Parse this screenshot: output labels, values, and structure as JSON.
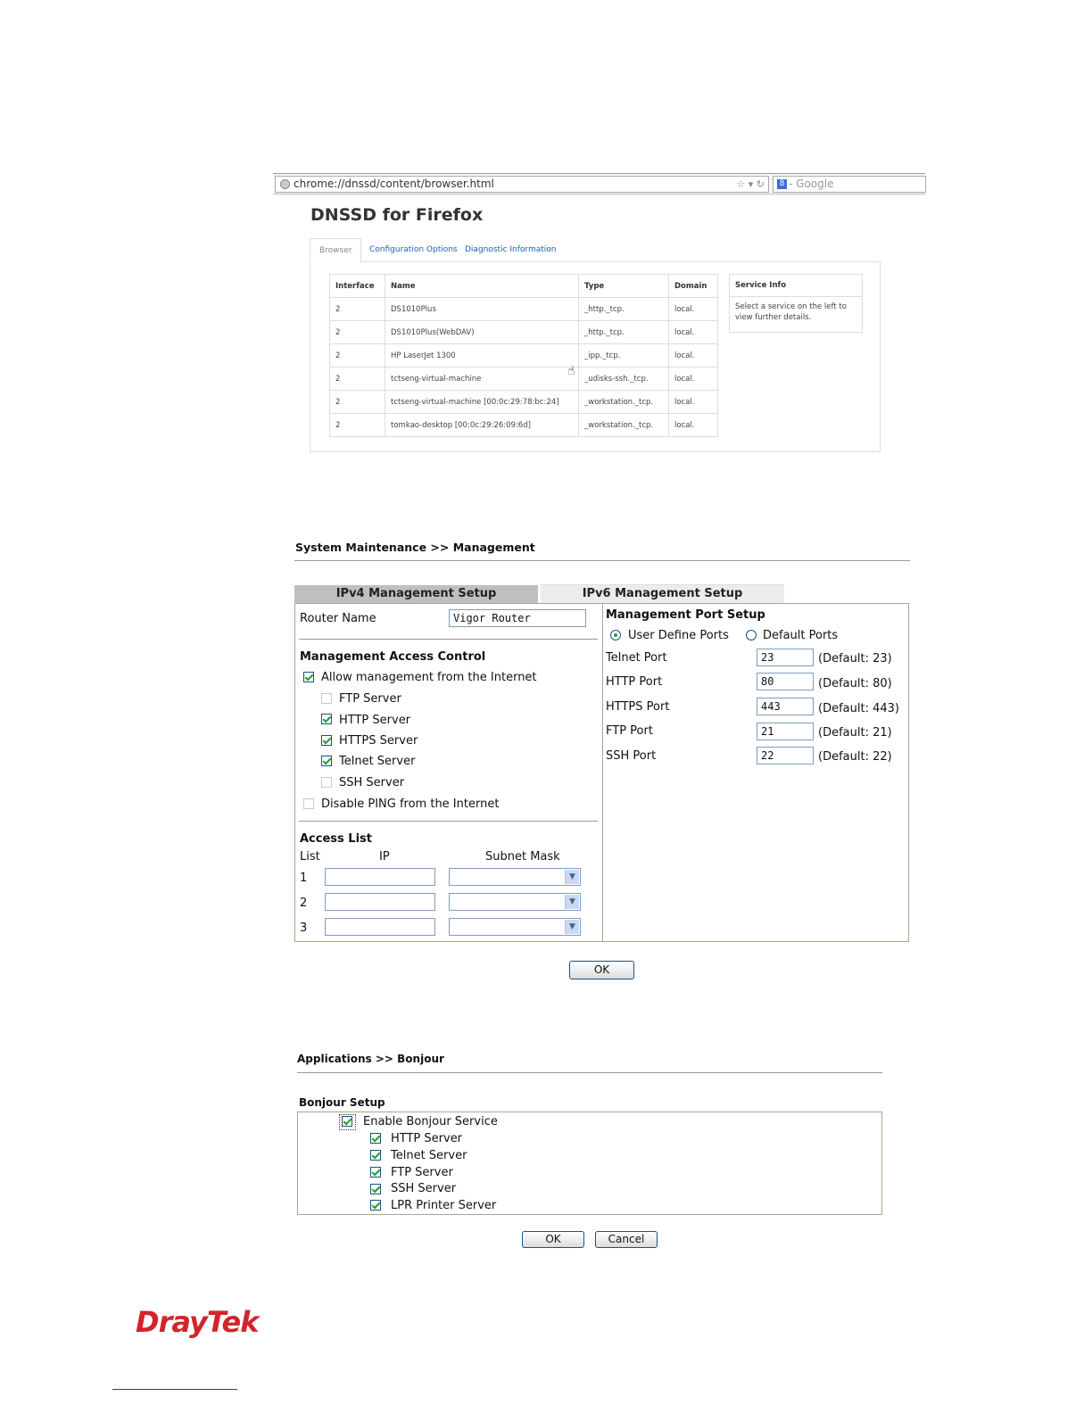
{
  "dnssd": {
    "url": "chrome://dnssd/content/browser.html",
    "search_placeholder": "Google",
    "title": "DNSSD for Firefox",
    "tabs": [
      "Browser",
      "Configuration Options",
      "Diagnostic Information"
    ],
    "columns": [
      "Interface",
      "Name",
      "Type",
      "Domain"
    ],
    "rows": [
      {
        "interface": "2",
        "name": "DS1010Plus",
        "type": "_http._tcp.",
        "domain": "local."
      },
      {
        "interface": "2",
        "name": "DS1010Plus(WebDAV)",
        "type": "_http._tcp.",
        "domain": "local."
      },
      {
        "interface": "2",
        "name": "HP LaserJet 1300",
        "type": "_ipp._tcp.",
        "domain": "local."
      },
      {
        "interface": "2",
        "name": "tctseng-virtual-machine",
        "type": "_udisks-ssh._tcp.",
        "domain": "local."
      },
      {
        "interface": "2",
        "name": "tctseng-virtual-machine [00:0c:29:78:bc:24]",
        "type": "_workstation._tcp.",
        "domain": "local."
      },
      {
        "interface": "2",
        "name": "tomkao-desktop [00:0c:29:26:09:6d]",
        "type": "_workstation._tcp.",
        "domain": "local."
      }
    ],
    "service_info": {
      "title": "Service Info",
      "text": "Select a service on the left to view further details."
    }
  },
  "management": {
    "breadcrumb": "System Maintenance >> Management",
    "tabs": {
      "ipv4": "IPv4 Management Setup",
      "ipv6": "IPv6 Management Setup"
    },
    "router_name": {
      "label": "Router Name",
      "value": "Vigor Router"
    },
    "access_control": {
      "title": "Management Access Control",
      "allow_internet": {
        "label": "Allow management from the Internet",
        "checked": true
      },
      "servers": [
        {
          "label": "FTP Server",
          "checked": false
        },
        {
          "label": "HTTP Server",
          "checked": true
        },
        {
          "label": "HTTPS Server",
          "checked": true
        },
        {
          "label": "Telnet Server",
          "checked": true
        },
        {
          "label": "SSH Server",
          "checked": false
        }
      ],
      "disable_ping": {
        "label": "Disable PING from the Internet",
        "checked": false
      }
    },
    "access_list": {
      "title": "Access List",
      "col_list": "List",
      "col_ip": "IP",
      "col_mask": "Subnet Mask",
      "rows": [
        "1",
        "2",
        "3"
      ]
    },
    "port_setup": {
      "title": "Management Port Setup",
      "user_define": "User Define Ports",
      "default_ports": "Default Ports",
      "ports": [
        {
          "label": "Telnet Port",
          "value": "23",
          "default": "(Default: 23)"
        },
        {
          "label": "HTTP Port",
          "value": "80",
          "default": "(Default: 80)"
        },
        {
          "label": "HTTPS Port",
          "value": "443",
          "default": "(Default: 443)"
        },
        {
          "label": "FTP Port",
          "value": "21",
          "default": "(Default: 21)"
        },
        {
          "label": "SSH Port",
          "value": "22",
          "default": "(Default: 22)"
        }
      ]
    },
    "ok": "OK"
  },
  "bonjour": {
    "breadcrumb": "Applications >> Bonjour",
    "section": "Bonjour Setup",
    "enable": "Enable Bonjour Service",
    "services": [
      "HTTP Server",
      "Telnet Server",
      "FTP Server",
      "SSH Server",
      "LPR Printer Server"
    ],
    "ok": "OK",
    "cancel": "Cancel"
  },
  "brand": {
    "logo": "DrayTek",
    "color": "#d3242b"
  }
}
